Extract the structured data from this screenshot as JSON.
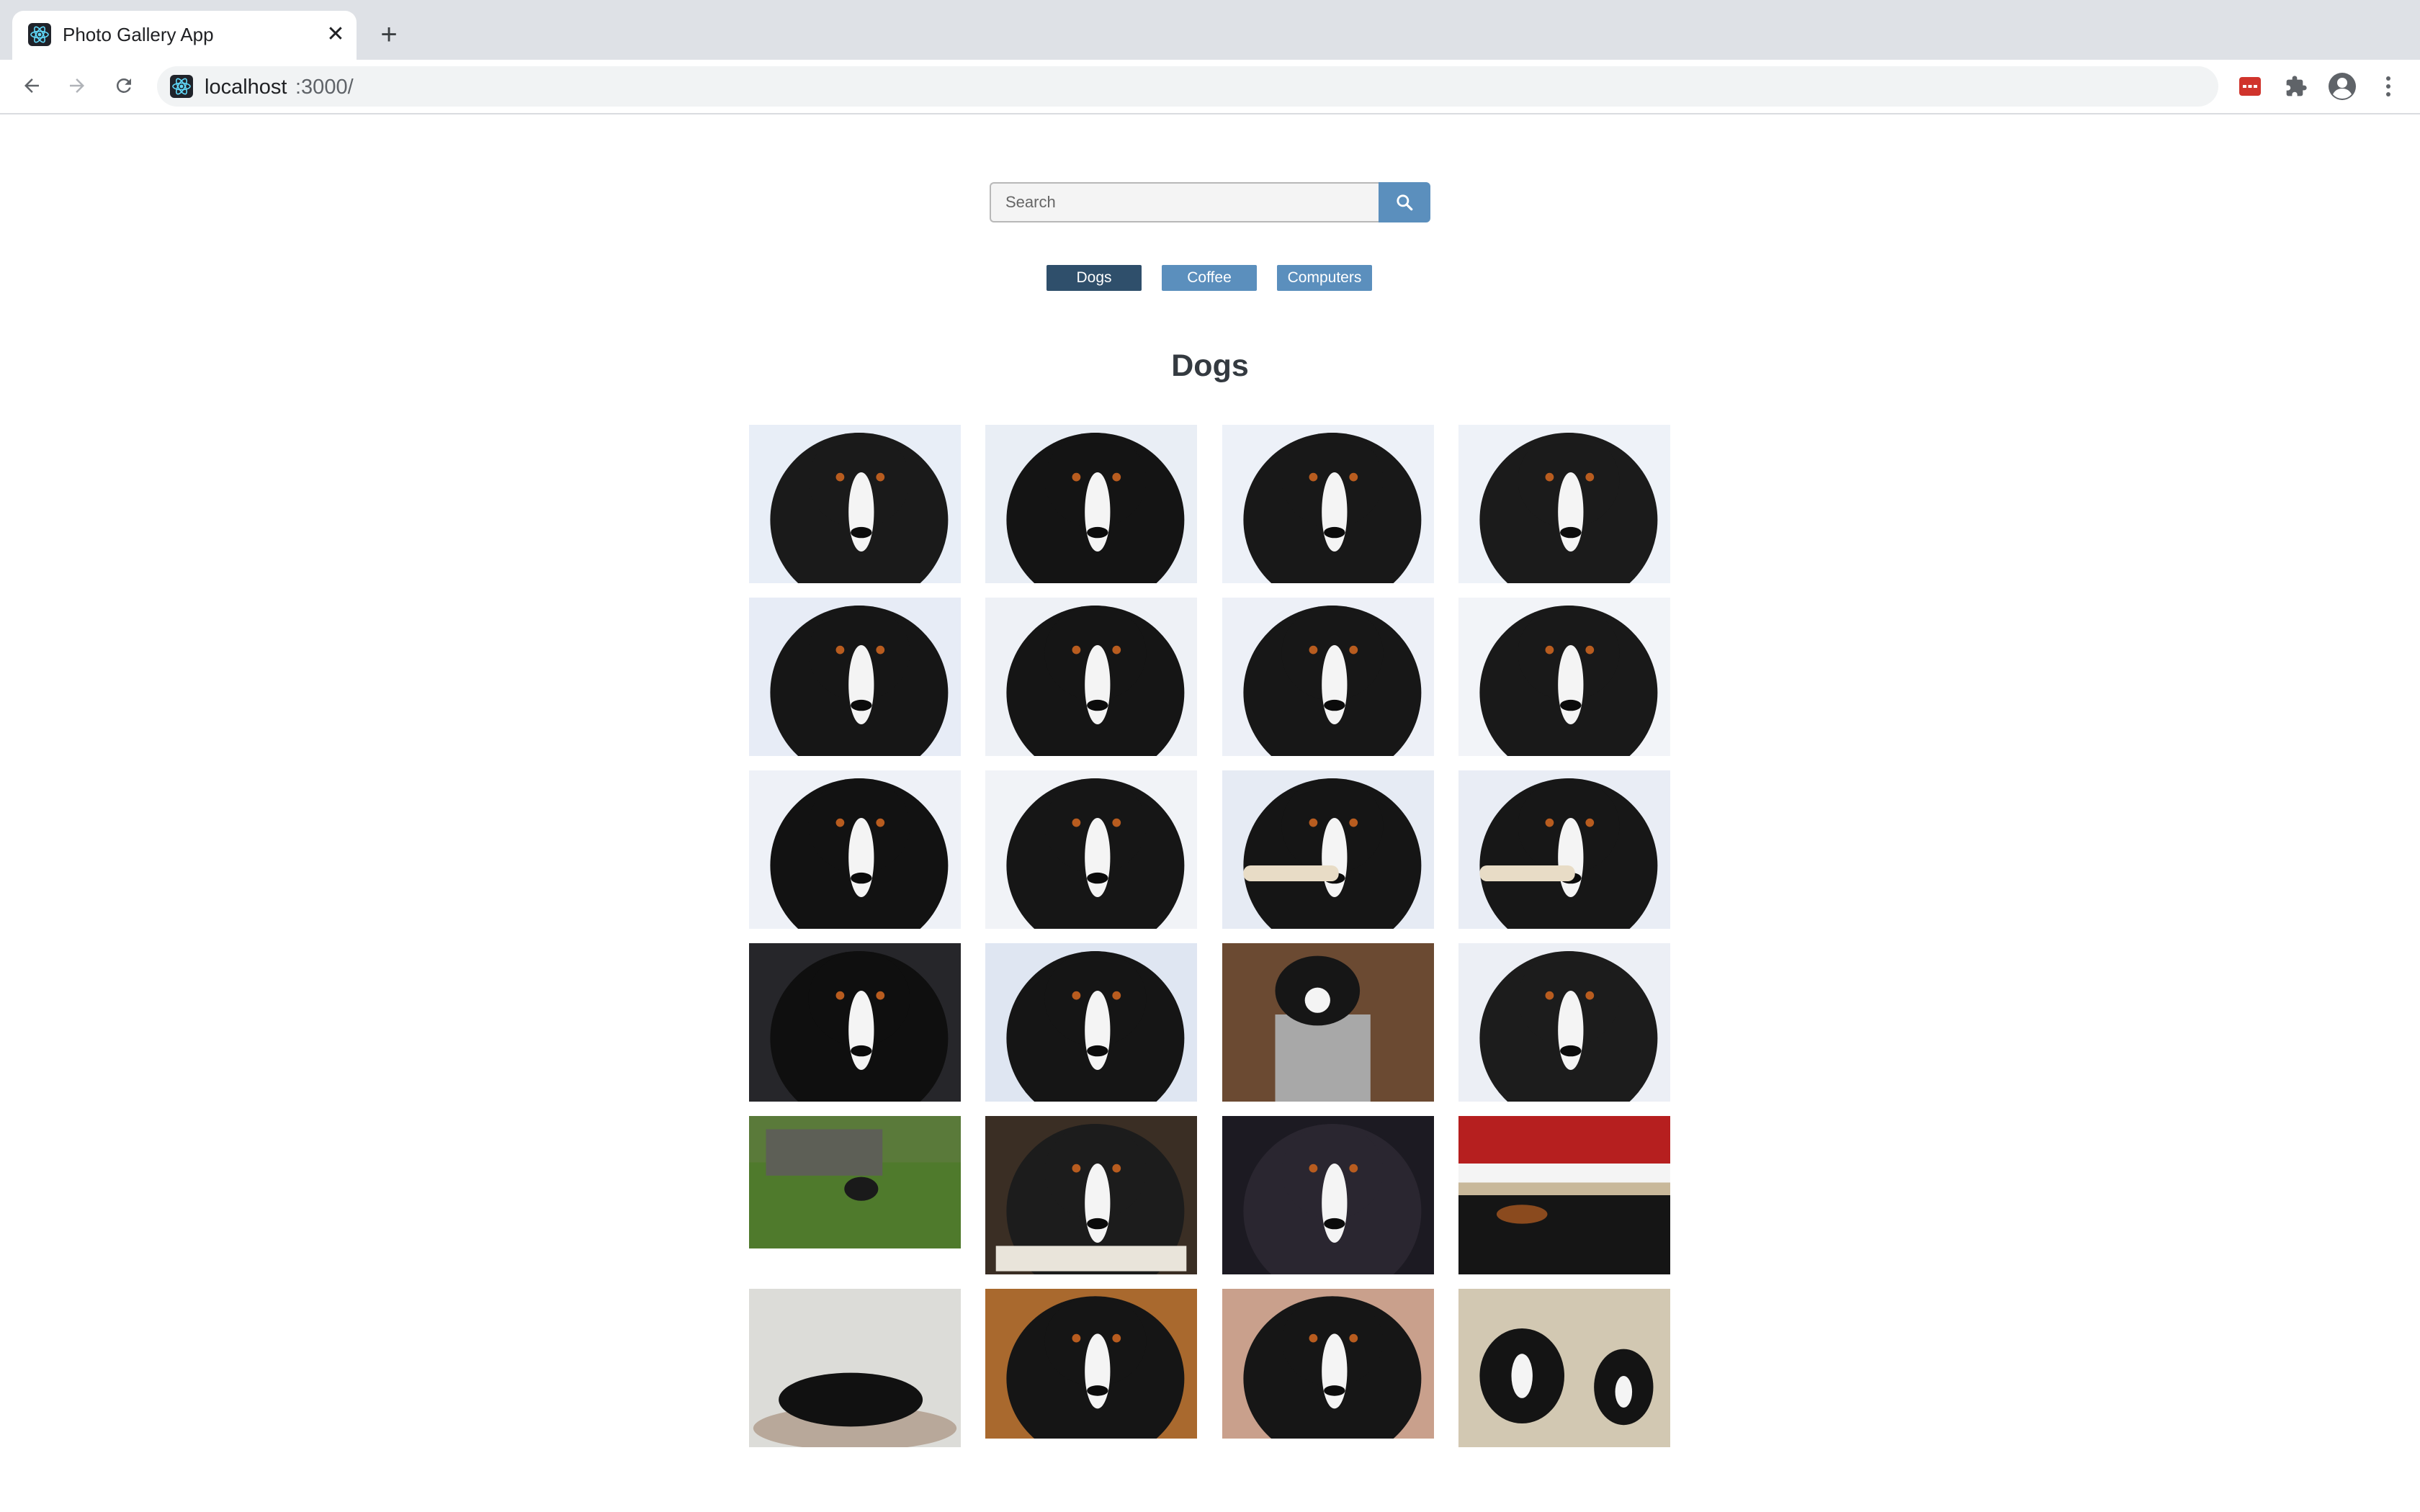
{
  "browser": {
    "tab_title": "Photo Gallery App",
    "url_host": "localhost",
    "url_rest": ":3000/"
  },
  "search": {
    "placeholder": "Search"
  },
  "categories": [
    {
      "label": "Dogs",
      "color": "#2f4f6b"
    },
    {
      "label": "Coffee",
      "color": "#5b8fbd"
    },
    {
      "label": "Computers",
      "color": "#5b8fbd"
    }
  ],
  "gallery": {
    "title": "Dogs",
    "photos": [
      {
        "scene": "snow-dog",
        "bg": "#e8eef7",
        "subject": "#1a1a1a"
      },
      {
        "scene": "snow-dog",
        "bg": "#e9eef5",
        "subject": "#141414"
      },
      {
        "scene": "snow-dog",
        "bg": "#edf1f8",
        "subject": "#181818"
      },
      {
        "scene": "snow-dog",
        "bg": "#eef2f8",
        "subject": "#1b1b1b"
      },
      {
        "scene": "snow-dog",
        "bg": "#e7ecf6",
        "subject": "#161616"
      },
      {
        "scene": "snow-dog",
        "bg": "#eef1f6",
        "subject": "#151515"
      },
      {
        "scene": "snow-dog",
        "bg": "#edf0f7",
        "subject": "#171717"
      },
      {
        "scene": "snow-dog-lying",
        "bg": "#f2f4f8",
        "subject": "#191919"
      },
      {
        "scene": "snow-dog",
        "bg": "#eef1f7",
        "subject": "#121212"
      },
      {
        "scene": "snow-dog-lying",
        "bg": "#f1f3f7",
        "subject": "#161616"
      },
      {
        "scene": "snow-dog-bone",
        "bg": "#e6ebf4",
        "subject": "#151515"
      },
      {
        "scene": "snow-dog-bone",
        "bg": "#e9edf5",
        "subject": "#171717"
      },
      {
        "scene": "dog-closeup",
        "bg": "#26262a",
        "subject": "#0f0f0f"
      },
      {
        "scene": "snow-dog-lying",
        "bg": "#dfe6f2",
        "subject": "#151515"
      },
      {
        "scene": "puppy-bucket",
        "bg": "#6b4a32",
        "subject": "#a8a8a8"
      },
      {
        "scene": "snow-dog",
        "bg": "#eceff5",
        "subject": "#1c1c1c"
      },
      {
        "scene": "field-dog",
        "bg": "#5a7a3a",
        "subject": "#1a1a1a"
      },
      {
        "scene": "dog-nose",
        "bg": "#3a2e24",
        "subject": "#1c1c1c"
      },
      {
        "scene": "dark-dog",
        "bg": "#1c1a22",
        "subject": "#2a2630"
      },
      {
        "scene": "santa-hat",
        "bg": "#c8b89a",
        "subject": "#151515"
      },
      {
        "scene": "dog-bed",
        "bg": "#dcdcd8",
        "subject": "#111111"
      },
      {
        "scene": "dog-profile",
        "bg": "#a9692e",
        "subject": "#151515"
      },
      {
        "scene": "dog-indoor",
        "bg": "#c9a08c",
        "subject": "#161616"
      },
      {
        "scene": "two-dogs",
        "bg": "#d2c8b2",
        "subject": "#141414"
      }
    ]
  }
}
